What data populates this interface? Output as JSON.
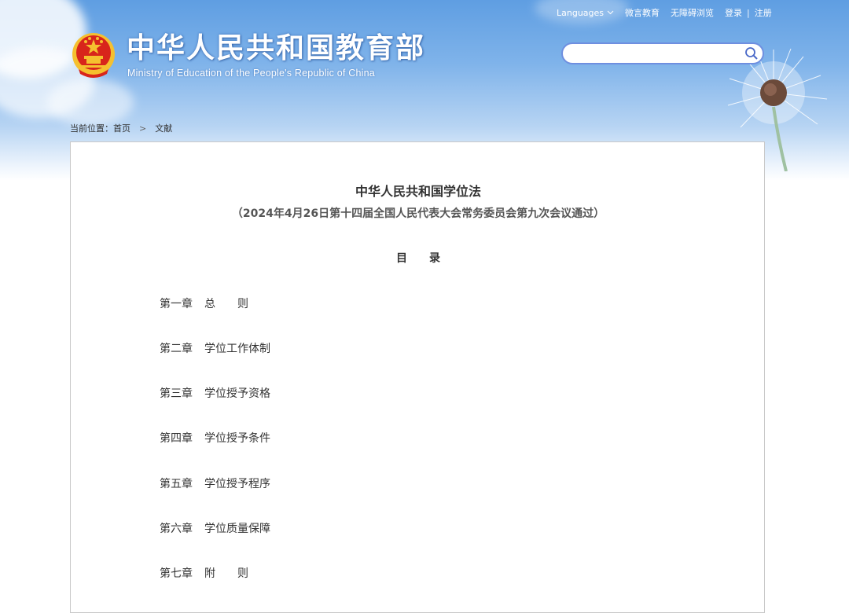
{
  "header": {
    "title_cn": "中华人民共和国教育部",
    "title_en": "Ministry of Education of the People's Republic of China",
    "nav": {
      "languages": "Languages",
      "weiyan": "微言教育",
      "accessible": "无障碍浏览",
      "login": "登录",
      "separator": "|",
      "register": "注册"
    },
    "search": {
      "value": "",
      "placeholder": ""
    }
  },
  "breadcrumb": {
    "prefix": "当前位置：",
    "home": "首页",
    "separator": ">",
    "current": "文献"
  },
  "document": {
    "title": "中华人民共和国学位法",
    "subtitle": "（2024年4月26日第十四届全国人民代表大会常务委员会第九次会议通过）",
    "toc_heading": {
      "first": "目",
      "second": "录"
    },
    "toc": [
      {
        "number": "第一章",
        "title": "总　　则"
      },
      {
        "number": "第二章",
        "title": "学位工作体制"
      },
      {
        "number": "第三章",
        "title": "学位授予资格"
      },
      {
        "number": "第四章",
        "title": "学位授予条件"
      },
      {
        "number": "第五章",
        "title": "学位授予程序"
      },
      {
        "number": "第六章",
        "title": "学位质量保障"
      },
      {
        "number": "第七章",
        "title": "附　　则"
      }
    ]
  },
  "colors": {
    "sky_top": "#5f9ee2",
    "search_border": "#6f8fe0",
    "text": "#333333",
    "emblem_red": "#d8251b",
    "emblem_gold": "#f5c02f"
  }
}
